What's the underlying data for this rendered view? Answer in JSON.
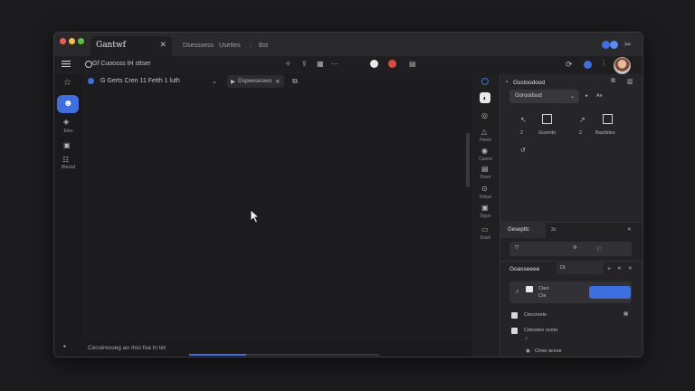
{
  "window": {
    "tab_title": "Gantwf",
    "tab_links": [
      "Dsessoess",
      "Usettes",
      "Bst"
    ]
  },
  "address": {
    "url": "Gf Cuoosss tH sttser"
  },
  "main": {
    "breadcrumb": "G Gerts Cren 11 Fetth 1 luth",
    "chip_label": "Dspeeseswo",
    "status_text": "Cecutrecoeg ao rtoo foa tn tet",
    "progress": 0.3
  },
  "rail": {
    "labels": [
      "Etes",
      "Btessd"
    ]
  },
  "column": {
    "labels": [
      "Heets",
      "Caone",
      "Dnex",
      "Detue",
      "Dgun",
      "Dosh",
      "Rout"
    ]
  },
  "panel": {
    "header": "Gsstoodood",
    "select_value": "Goroodsud",
    "select_side": "Ae",
    "tools": [
      {
        "label": "Gcemtn"
      },
      {
        "label": "Bazrbtes"
      }
    ],
    "tool_side_labels": [
      "2",
      "2"
    ],
    "section2_tab": "Gesepttc",
    "section2_tab_right": "2c",
    "section3_header": "Goasseeee",
    "section3_field": "Dt",
    "card_line1": "Cteo",
    "card_line2": "Cte",
    "list": [
      {
        "label": "Cteconete"
      },
      {
        "label": "Cdeodee ocete"
      }
    ],
    "list_sub": "Ctree acese"
  },
  "colors": {
    "accent": "#3d6fe0",
    "background": "#1f1f22",
    "traffic": [
      "#ec5f56",
      "#f3bd4f",
      "#5ec248"
    ]
  }
}
